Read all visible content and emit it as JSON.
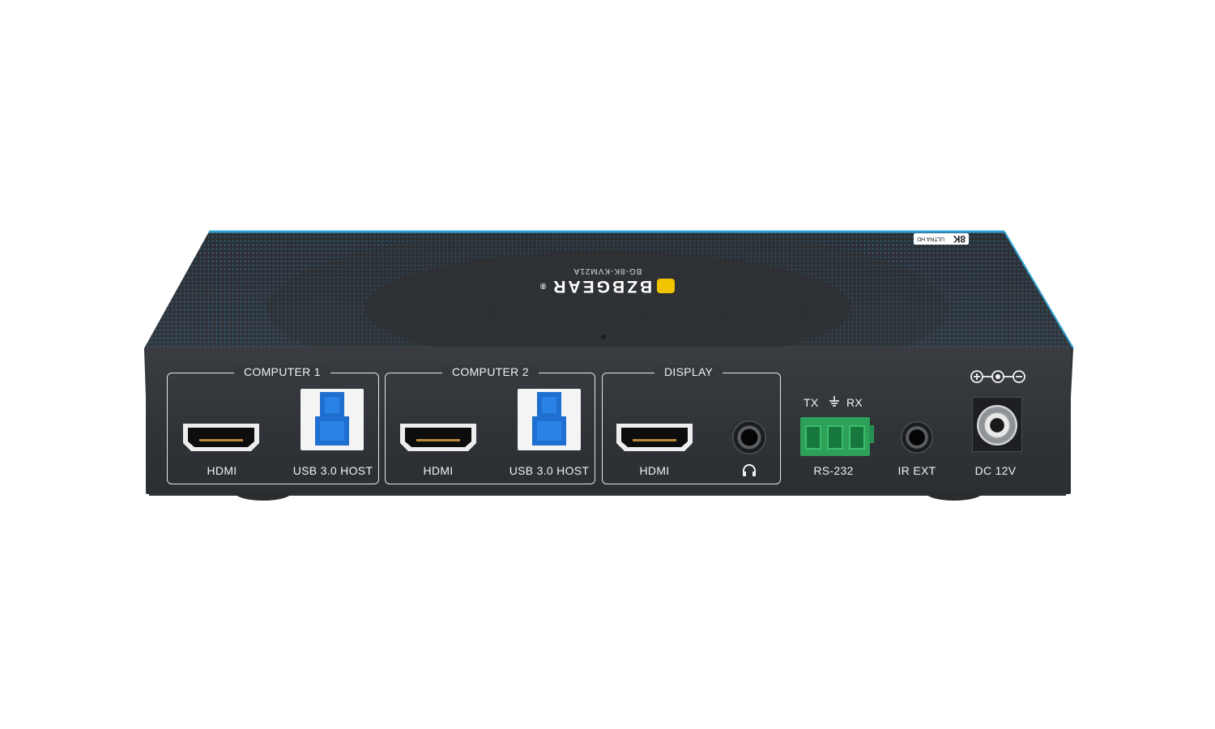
{
  "brand": {
    "name": "BZBGEAR",
    "registered_mark": "®",
    "model": "BG-8K-KVM21A",
    "badge_big": "8K",
    "badge_small": "ULTRA HD"
  },
  "colors": {
    "chassis": "#2f3236",
    "accent_edge": "#2f9fcf",
    "dot_pattern": "#2a8ccc",
    "usb_blue": "#1e6fd0",
    "terminal_green": "#2da05a",
    "logo_yellow": "#f2c400"
  },
  "groups": {
    "computer1": {
      "title": "COMPUTER 1",
      "hdmi_label": "HDMI",
      "usb_label": "USB 3.0 HOST"
    },
    "computer2": {
      "title": "COMPUTER 2",
      "hdmi_label": "HDMI",
      "usb_label": "USB 3.0 HOST"
    },
    "display": {
      "title": "DISPLAY",
      "hdmi_label": "HDMI",
      "audio_icon": "headphones-icon"
    }
  },
  "rs232": {
    "tx": "TX",
    "gnd_icon": "ground-icon",
    "rx": "RX",
    "label": "RS-232"
  },
  "ir": {
    "label": "IR EXT"
  },
  "dc": {
    "polarity_icon": "dc-polarity-icon",
    "label": "DC 12V"
  }
}
